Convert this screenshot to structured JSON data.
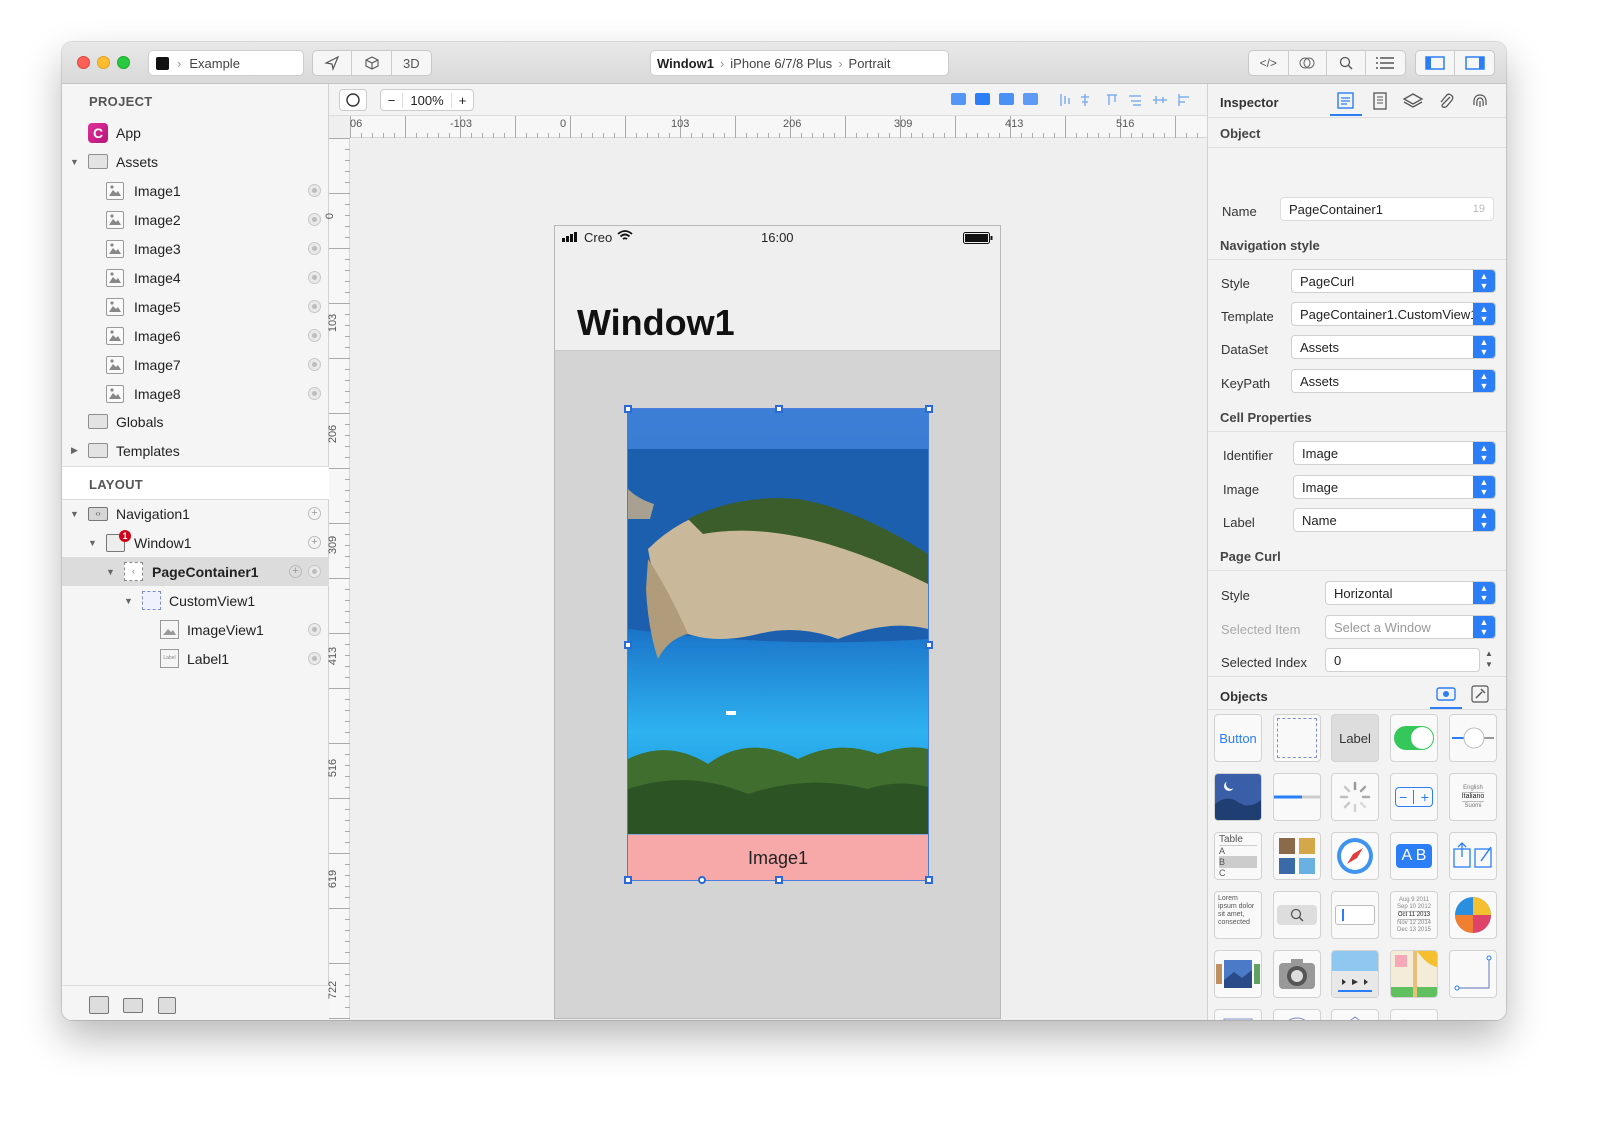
{
  "window": {
    "project_name": "Example",
    "view_3d_label": "3D",
    "breadcrumb": [
      "Window1",
      "iPhone 6/7/8 Plus",
      "Portrait"
    ]
  },
  "sidebar": {
    "project_header": "PROJECT",
    "app_label": "App",
    "assets_label": "Assets",
    "assets": [
      "Image1",
      "Image2",
      "Image3",
      "Image4",
      "Image5",
      "Image6",
      "Image7",
      "Image8"
    ],
    "globals_label": "Globals",
    "templates_label": "Templates",
    "layout_header": "LAYOUT",
    "layout": {
      "navigation": "Navigation1",
      "window": "Window1",
      "window_badge": "1",
      "page_container": "PageContainer1",
      "custom_view": "CustomView1",
      "image_view": "ImageView1",
      "label": "Label1"
    }
  },
  "canvas": {
    "zoom": "100%",
    "ruler_h": [
      "06",
      "-103",
      "0",
      "103",
      "206",
      "309",
      "413",
      "516"
    ],
    "ruler_v": [
      "0",
      "103",
      "206",
      "309",
      "413",
      "516",
      "619",
      "722"
    ],
    "device": {
      "carrier": "Creo",
      "time": "16:00",
      "title": "Window1",
      "caption": "Image1"
    }
  },
  "inspector": {
    "title": "Inspector",
    "object_header": "Object",
    "name_label": "Name",
    "name_value": "PageContainer1",
    "name_count": "19",
    "nav_style_header": "Navigation style",
    "style_label": "Style",
    "style_value": "PageCurl",
    "template_label": "Template",
    "template_value": "PageContainer1.CustomView1",
    "dataset_label": "DataSet",
    "dataset_value": "Assets",
    "keypath_label": "KeyPath",
    "keypath_value": "Assets",
    "cell_header": "Cell Properties",
    "identifier_label": "Identifier",
    "identifier_value": "Image",
    "image_label": "Image",
    "image_value": "Image",
    "label_label": "Label",
    "label_value": "Name",
    "curl_header": "Page Curl",
    "curl_style_label": "Style",
    "curl_style_value": "Horizontal",
    "selected_item_label": "Selected Item",
    "selected_item_value": "Select a Window",
    "selected_index_label": "Selected Index",
    "selected_index_value": "0",
    "objects_header": "Objects",
    "objects": {
      "button": "Button",
      "label": "Label",
      "table": "Table",
      "table_rows": [
        "A",
        "B",
        "C"
      ],
      "ab": "A B",
      "lorem": "Lorem ipsum dolor sit amet, consected",
      "picker": [
        "English",
        "Italiano",
        "Suomi"
      ],
      "dates": [
        "Aug 9 2011",
        "Sep 10 2012",
        "Oct 11 2013",
        "Nov 12 2014",
        "Dec 13 2015"
      ]
    }
  },
  "colors": {
    "accent": "#2b7ef5",
    "caption_bg": "#f7a8a8",
    "selection": "#dcdcdc",
    "badge": "#d0021b"
  }
}
